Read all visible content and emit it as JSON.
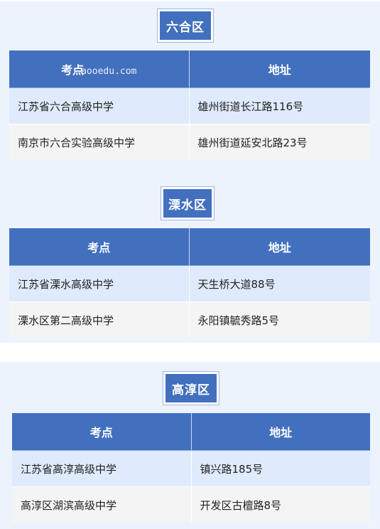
{
  "header_labels": {
    "exam_site": "考点",
    "address": "地址"
  },
  "watermark": "aooedu.com",
  "districts": [
    {
      "name": "六合区",
      "rows": [
        {
          "site": "江苏省六合高级中学",
          "address": "雄州街道长江路116号"
        },
        {
          "site": "南京市六合实验高级中学",
          "address": "雄州街道延安北路23号"
        }
      ]
    },
    {
      "name": "溧水区",
      "rows": [
        {
          "site": "江苏省溧水高级中学",
          "address": "天生桥大道88号"
        },
        {
          "site": "溧水区第二高级中学",
          "address": "永阳镇毓秀路5号"
        }
      ]
    },
    {
      "name": "高淳区",
      "rows": [
        {
          "site": "江苏省高淳高级中学",
          "address": "镇兴路185号"
        },
        {
          "site": "高淳区湖滨高级中学",
          "address": "开发区古檀路8号"
        }
      ]
    }
  ]
}
